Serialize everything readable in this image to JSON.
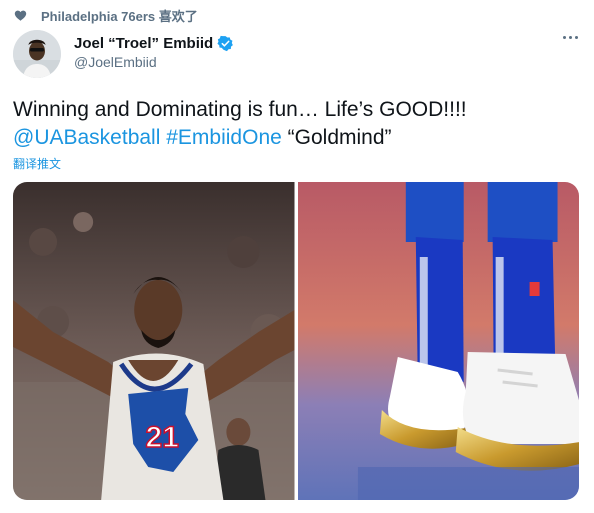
{
  "liked_by": {
    "icon": "heart-icon",
    "text": "Philadelphia 76ers 喜欢了"
  },
  "author": {
    "display_name": "Joel “Troel” Embiid",
    "handle": "@JoelEmbiid",
    "avatar_icon": "avatar",
    "verified_icon": "verified-badge-icon"
  },
  "tweet": {
    "line1": "Winning and Dominating is fun… Life’s GOOD!!!!",
    "mention": "@UABasketball",
    "hashtag": "#EmbiidOne",
    "quote": "“Goldmind”",
    "translate_label": "翻译推文"
  },
  "media": {
    "left_photo": {
      "jersey_number": "21"
    },
    "right_photo": {}
  },
  "colors": {
    "link": "#1b95e0",
    "secondary_text": "#5b7083",
    "verified": "#1da1f2"
  }
}
